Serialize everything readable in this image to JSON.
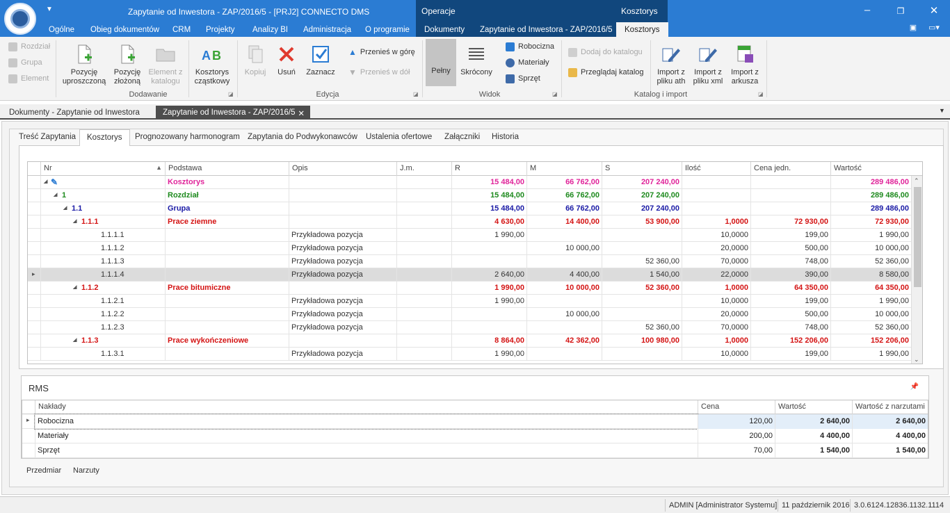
{
  "window": {
    "title": "Zapytanie od Inwestora - ZAP/2016/5 - [PRJ2] CONNECTO DMS",
    "ctx_left": "Operacje",
    "ctx_right": "Kosztorys"
  },
  "menu_tabs": [
    "Ogólne",
    "Obieg dokumentów",
    "CRM",
    "Projekty",
    "Analizy BI",
    "Administracja",
    "O programie"
  ],
  "ctx_tabs": [
    "Dokumenty",
    "Zapytanie od Inwestora - ZAP/2016/5",
    "Kosztorys"
  ],
  "ribbon": {
    "nav_items": [
      "Rozdział",
      "Grupa",
      "Element"
    ],
    "dodawanie": {
      "label": "Dodawanie",
      "buttons": [
        "Pozycję\nuproszczoną",
        "Pozycję\nzłożoną",
        "Element z\nkatalogu",
        "Kosztorys\ncząstkowy"
      ]
    },
    "edycja": {
      "label": "Edycja",
      "kopiuj": "Kopiuj",
      "usun": "Usuń",
      "zaznacz": "Zaznacz",
      "move_up": "Przenieś w górę",
      "move_down": "Przenieś w dół"
    },
    "widok": {
      "label": "Widok",
      "pelny": "Pełny",
      "skrocony": "Skrócony",
      "robocizna": "Robocizna",
      "materialy": "Materiały",
      "sprzet": "Sprzęt"
    },
    "katalog": {
      "label": "Katalog i import",
      "dodaj": "Dodaj do katalogu",
      "przegladaj": "Przeglądaj katalog",
      "import_ath": "Import z\npliku ath",
      "import_xml": "Import z\npliku xml",
      "import_xls": "Import z\narkusza"
    }
  },
  "doc_tabs": [
    "Dokumenty - Zapytanie od Inwestora",
    "Zapytanie od Inwestora - ZAP/2016/5"
  ],
  "page_tabs": [
    "Treść Zapytania",
    "Kosztorys",
    "Prognozowany harmonogram",
    "Zapytania do Podwykonawców",
    "Ustalenia ofertowe",
    "Załączniki",
    "Historia"
  ],
  "grid": {
    "columns": [
      "Nr",
      "Podstawa",
      "Opis",
      "J.m.",
      "R",
      "M",
      "S",
      "Ilość",
      "Cena jedn.",
      "Wartość"
    ],
    "rows": [
      {
        "level": 0,
        "nr": "",
        "podstawa": "Kosztorys",
        "opis": "",
        "r": "15 484,00",
        "m": "66 762,00",
        "s": "207 240,00",
        "ilosc": "",
        "cena": "",
        "wartosc": "289 486,00",
        "color": "#e0249a",
        "bold": true
      },
      {
        "level": 1,
        "nr": "1",
        "podstawa": "Rozdział",
        "opis": "",
        "r": "15 484,00",
        "m": "66 762,00",
        "s": "207 240,00",
        "ilosc": "",
        "cena": "",
        "wartosc": "289 486,00",
        "color": "#1e8a1e",
        "bold": true
      },
      {
        "level": 2,
        "nr": "1.1",
        "podstawa": "Grupa",
        "opis": "",
        "r": "15 484,00",
        "m": "66 762,00",
        "s": "207 240,00",
        "ilosc": "",
        "cena": "",
        "wartosc": "289 486,00",
        "color": "#1a1aa6",
        "bold": true
      },
      {
        "level": 3,
        "nr": "1.1.1",
        "podstawa": "Prace ziemne",
        "opis": "",
        "r": "4 630,00",
        "m": "14 400,00",
        "s": "53 900,00",
        "ilosc": "1,0000",
        "cena": "72 930,00",
        "wartosc": "72 930,00",
        "color": "#d41414",
        "bold": true
      },
      {
        "level": 4,
        "nr": "1.1.1.1",
        "podstawa": "",
        "opis": "Przykładowa pozycja",
        "r": "1 990,00",
        "m": "",
        "s": "",
        "ilosc": "10,0000",
        "cena": "199,00",
        "wartosc": "1 990,00",
        "color": "#333333",
        "bold": false
      },
      {
        "level": 4,
        "nr": "1.1.1.2",
        "podstawa": "",
        "opis": "Przykładowa pozycja",
        "r": "",
        "m": "10 000,00",
        "s": "",
        "ilosc": "20,0000",
        "cena": "500,00",
        "wartosc": "10 000,00",
        "color": "#333333",
        "bold": false
      },
      {
        "level": 4,
        "nr": "1.1.1.3",
        "podstawa": "",
        "opis": "Przykładowa pozycja",
        "r": "",
        "m": "",
        "s": "52 360,00",
        "ilosc": "70,0000",
        "cena": "748,00",
        "wartosc": "52 360,00",
        "color": "#333333",
        "bold": false
      },
      {
        "level": 4,
        "nr": "1.1.1.4",
        "podstawa": "",
        "opis": "Przykładowa pozycja",
        "r": "2 640,00",
        "m": "4 400,00",
        "s": "1 540,00",
        "ilosc": "22,0000",
        "cena": "390,00",
        "wartosc": "8 580,00",
        "color": "#333333",
        "bold": false,
        "selected": true
      },
      {
        "level": 3,
        "nr": "1.1.2",
        "podstawa": "Prace bitumiczne",
        "opis": "",
        "r": "1 990,00",
        "m": "10 000,00",
        "s": "52 360,00",
        "ilosc": "1,0000",
        "cena": "64 350,00",
        "wartosc": "64 350,00",
        "color": "#d41414",
        "bold": true
      },
      {
        "level": 4,
        "nr": "1.1.2.1",
        "podstawa": "",
        "opis": "Przykładowa pozycja",
        "r": "1 990,00",
        "m": "",
        "s": "",
        "ilosc": "10,0000",
        "cena": "199,00",
        "wartosc": "1 990,00",
        "color": "#333333",
        "bold": false
      },
      {
        "level": 4,
        "nr": "1.1.2.2",
        "podstawa": "",
        "opis": "Przykładowa pozycja",
        "r": "",
        "m": "10 000,00",
        "s": "",
        "ilosc": "20,0000",
        "cena": "500,00",
        "wartosc": "10 000,00",
        "color": "#333333",
        "bold": false
      },
      {
        "level": 4,
        "nr": "1.1.2.3",
        "podstawa": "",
        "opis": "Przykładowa pozycja",
        "r": "",
        "m": "",
        "s": "52 360,00",
        "ilosc": "70,0000",
        "cena": "748,00",
        "wartosc": "52 360,00",
        "color": "#333333",
        "bold": false
      },
      {
        "level": 3,
        "nr": "1.1.3",
        "podstawa": "Prace wykończeniowe",
        "opis": "",
        "r": "8 864,00",
        "m": "42 362,00",
        "s": "100 980,00",
        "ilosc": "1,0000",
        "cena": "152 206,00",
        "wartosc": "152 206,00",
        "color": "#d41414",
        "bold": true
      },
      {
        "level": 4,
        "nr": "1.1.3.1",
        "podstawa": "",
        "opis": "Przykładowa pozycja",
        "r": "1 990,00",
        "m": "",
        "s": "",
        "ilosc": "10,0000",
        "cena": "199,00",
        "wartosc": "1 990,00",
        "color": "#333333",
        "bold": false
      }
    ]
  },
  "rms": {
    "title": "RMS",
    "columns": [
      "Nakłady",
      "Cena",
      "Wartość",
      "Wartość z narzutami"
    ],
    "rows": [
      {
        "naklady": "Robocizna",
        "cena": "120,00",
        "wartosc": "2 640,00",
        "narzut": "2 640,00"
      },
      {
        "naklady": "Materiały",
        "cena": "200,00",
        "wartosc": "4 400,00",
        "narzut": "4 400,00"
      },
      {
        "naklady": "Sprzęt",
        "cena": "70,00",
        "wartosc": "1 540,00",
        "narzut": "1 540,00"
      }
    ]
  },
  "bottom_tabs": [
    "Przedmiar",
    "Narzuty"
  ],
  "status": {
    "user": "ADMIN [Administrator Systemu]",
    "date": "11 październik 2016",
    "version": "3.0.6124.12836.1132.1114"
  },
  "colors": {
    "title_bar": "#2b7cd3",
    "context_panel": "#11477d",
    "accent": "#2b7cd3"
  }
}
